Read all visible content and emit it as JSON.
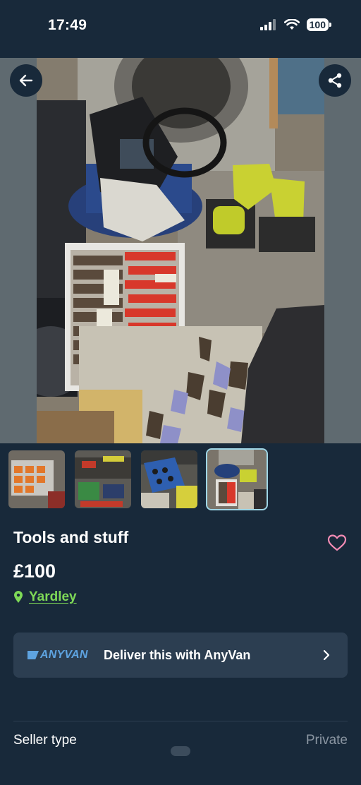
{
  "status_bar": {
    "time": "17:49",
    "battery": "100"
  },
  "listing": {
    "title": "Tools and stuff",
    "price": "£100",
    "location": "Yardley",
    "image_count": 4,
    "selected_image": 4
  },
  "delivery": {
    "brand": "ANYVAN",
    "label": "Deliver this with AnyVan"
  },
  "details": [
    {
      "label": "Seller type",
      "value": "Private"
    }
  ],
  "icons": {
    "back": "arrow-left-icon",
    "share": "share-icon",
    "favourite": "heart-icon",
    "location": "map-pin-icon",
    "chevron": "chevron-right-icon"
  },
  "colors": {
    "background": "#18293a",
    "card": "#2c3e51",
    "accent_green": "#7ed957",
    "heart_pink": "#f28bb4",
    "muted_text": "#8b96a2",
    "thumb_border": "#9fd6e6"
  }
}
